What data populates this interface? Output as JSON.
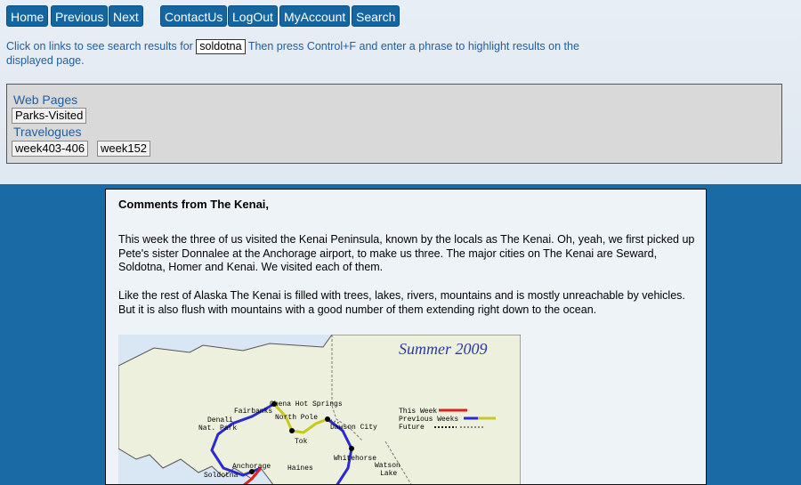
{
  "nav": {
    "home": "Home",
    "previous": "Previous",
    "next": "Next",
    "contact": "ContactUs",
    "logout": "LogOut",
    "account": "MyAccount",
    "search": "Search"
  },
  "hint": {
    "before": "Click on links to see search results for",
    "term": "soldotna",
    "after": "Then press Control+F and enter a phrase to highlight results on the displayed page."
  },
  "links": {
    "web_pages_label": "Web Pages",
    "web_pages": [
      "Parks-Visited"
    ],
    "travelogues_label": "Travelogues",
    "travelogues": [
      "week403-406",
      "week152"
    ]
  },
  "article": {
    "title": "Comments from The Kenai,",
    "para1": "This week the three of us visited the Kenai Peninsula, known by the locals as The Kenai.  Oh, yeah, we first picked up Pete's sister Donnalee at the Anchorage airport, to make us three. The major cities on The Kenai are Seward, Soldotna, Homer and Kenai.  We visited each of them.",
    "para2": "Like the rest of Alaska The Kenai is filled with trees, lakes, rivers, mountains and is mostly unreachable by vehicles. But it is also flush with mountains with a good number of them extending right down to the ocean."
  },
  "map": {
    "banner": "Summer 2009",
    "places": {
      "fairbanks": "Fairbanks",
      "chena": "Chena Hot Springs",
      "denali": "Denali",
      "natpark": "Nat. Park",
      "northpole": "North Pole",
      "dawson": "Dawson City",
      "tok": "Tok",
      "whitehorse": "Whitehorse",
      "anchorage": "Anchorage",
      "haines": "Haines",
      "watson": "Watson",
      "lake": "Lake",
      "soldotna": "Soldotna"
    },
    "legend": {
      "this_week": "This Week",
      "previous_weeks": "Previous Weeks",
      "future": "Future"
    },
    "colors": {
      "this_week": "#e02020",
      "previous_a": "#2a2ad0",
      "previous_b": "#c8c820",
      "future": "#222222",
      "banner": "#2a3aa0"
    }
  }
}
